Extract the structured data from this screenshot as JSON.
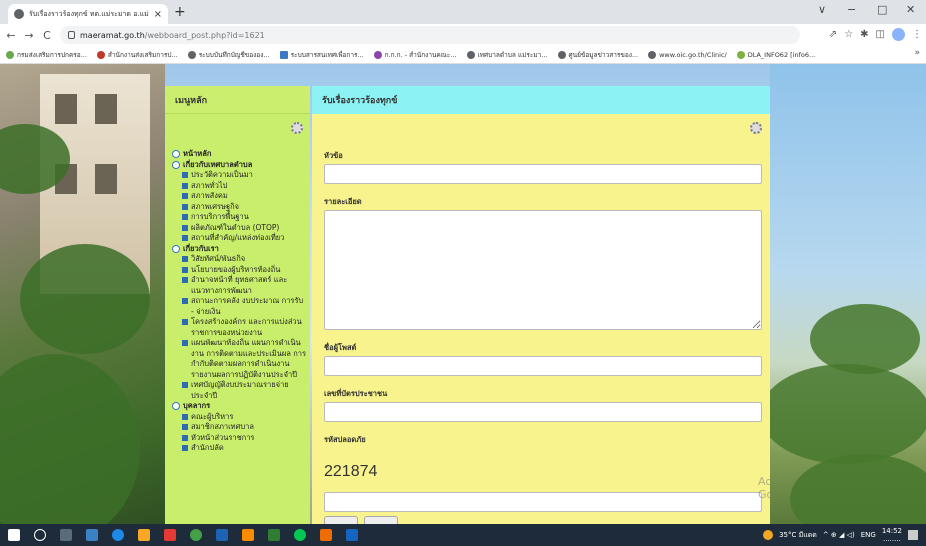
{
  "browser": {
    "tab_title": "รับเรื่องราวร้องทุกข์ ทต.แม่ระมาด อ.แม่...",
    "tab_close": "×",
    "new_tab": "+",
    "window_controls": [
      "∨",
      "−",
      "□",
      "✕"
    ],
    "nav_icons": [
      "←",
      "→",
      "C"
    ],
    "url_host": "maeramat.go.th",
    "url_path": "/webboard_post.php?id=1621",
    "toolbar_icons": [
      "⇗",
      "☆",
      "✱",
      "◫",
      "⋮"
    ],
    "bookmarks": [
      "กรมส่งเสริมการปกครอ...",
      "สำนักงานส่งเสริมการป...",
      "ระบบบันทึกบัญชีขององ...",
      "ระบบสารสนเทศเพื่อการ...",
      "ก.ก.ก. - สำนักงานคณะ...",
      "เทศบาลตำบล แม่ระมา...",
      "ศูนย์ข้อมูลข่าวสารของ...",
      "www.oic.go.th/Clinic/",
      "DLA_INFO62 [info6..."
    ],
    "bookmarks_more": "»"
  },
  "menu": {
    "title": "เมนูหลัก",
    "items": [
      {
        "level": 1,
        "label": "หน้าหลัก"
      },
      {
        "level": 1,
        "label": "เกี่ยวกับเทศบาลตำบล"
      },
      {
        "level": 2,
        "label": "ประวัติความเป็นมา"
      },
      {
        "level": 2,
        "label": "สภาพทั่วไป"
      },
      {
        "level": 2,
        "label": "สภาพสังคม"
      },
      {
        "level": 2,
        "label": "สภาพเศรษฐกิจ"
      },
      {
        "level": 2,
        "label": "การบริการพื้นฐาน"
      },
      {
        "level": 2,
        "label": "ผลิตภัณฑ์ในตำบล (OTOP)"
      },
      {
        "level": 2,
        "label": "สถานที่สำคัญ/แหล่งท่องเที่ยว"
      },
      {
        "level": 1,
        "label": "เกี่ยวกับเรา"
      },
      {
        "level": 2,
        "label": "วิสัยทัศน์/พันธกิจ"
      },
      {
        "level": 2,
        "label": "นโยบายของผู้บริหารท้องถิ่น"
      },
      {
        "level": 2,
        "label": "อำนาจหน้าที่ ยุทธศาสตร์ และแนวทางการพัฒนา"
      },
      {
        "level": 2,
        "label": "สถานะการคลัง งบประมาณ การรับ - จ่ายเงิน"
      },
      {
        "level": 2,
        "label": "โครงสร้างองค์กร และการแบ่งส่วนราชการของหน่วยงาน"
      },
      {
        "level": 2,
        "label": "แผนพัฒนาท้องถิ่น แผนการดำเนินงาน การติดตามและประเมินผล การกำกับติดตามผลการดำเนินงาน รายงานผลการปฏิบัติงานประจำปี"
      },
      {
        "level": 2,
        "label": "เทศบัญญัติงบประมาณรายจ่ายประจำปี"
      },
      {
        "level": 1,
        "label": "บุคลากร"
      },
      {
        "level": 2,
        "label": "คณะผู้บริหาร"
      },
      {
        "level": 2,
        "label": "สมาชิกสภาเทศบาล"
      },
      {
        "level": 2,
        "label": "หัวหน้าส่วนราชการ"
      },
      {
        "level": 2,
        "label": "สำนักปลัด"
      }
    ]
  },
  "form": {
    "title": "รับเรื่องราวร้องทุกข์",
    "subject_label": "หัวข้อ",
    "subject_value": "",
    "detail_label": "รายละเอียด",
    "detail_value": "",
    "poster_label": "ชื่อผู้โพสต์",
    "poster_value": "",
    "id_label": "เลขที่บัตรประชาชน",
    "id_value": "",
    "captcha_label": "รหัสปลอดภัย",
    "captcha_code": "221874",
    "captcha_value": ""
  },
  "watermark": "Ac\nGo",
  "taskbar": {
    "weather": "35°C มีแดด",
    "lang": "ENG",
    "tray_icons": "^ ⊕ ◢ ◁)",
    "time": "14:52",
    "date": "........"
  },
  "colors": {
    "menu_bg": "#c9ee6c",
    "content_bg": "#f8f38d",
    "content_head_bg": "#8df2f4",
    "taskbar_bg": "#1d2b3a"
  }
}
